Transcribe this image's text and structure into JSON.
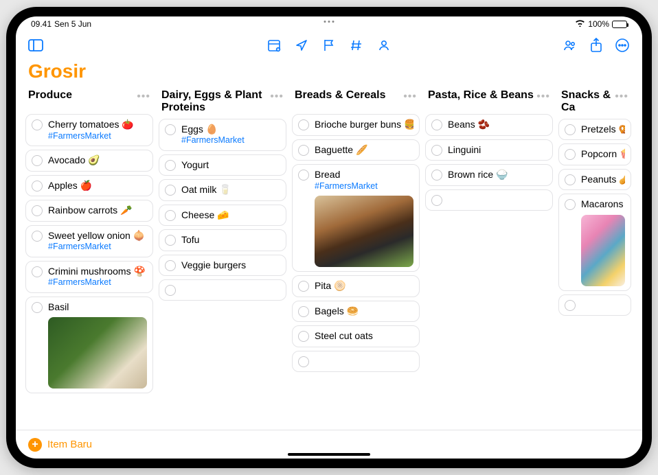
{
  "status": {
    "time": "09.41",
    "date": "Sen 5 Jun",
    "battery_pct": "100%",
    "wifi_icon": "wifi-icon",
    "battery_icon": "battery-icon"
  },
  "toolbar": {
    "sidebar_icon": "sidebar-toggle-icon",
    "calendar_icon": "calendar-icon",
    "location_icon": "location-icon",
    "flag_icon": "flag-icon",
    "hash_icon": "hash-icon",
    "person_icon": "person-icon",
    "share_icon": "share-icon",
    "collab_icon": "collaborate-icon",
    "more_icon": "ellipsis-circle-icon"
  },
  "title": "Grosir",
  "footer": {
    "new_item": "Item Baru"
  },
  "columns": [
    {
      "title": "Produce",
      "items": [
        {
          "label": "Cherry tomatoes 🍅",
          "tag": "#FarmersMarket"
        },
        {
          "label": "Avocado 🥑"
        },
        {
          "label": "Apples 🍎"
        },
        {
          "label": "Rainbow carrots 🥕"
        },
        {
          "label": "Sweet yellow onion 🧅",
          "tag": "#FarmersMarket"
        },
        {
          "label": "Crimini mushrooms 🍄",
          "tag": "#FarmersMarket"
        },
        {
          "label": "Basil",
          "image": "basil"
        }
      ]
    },
    {
      "title": "Dairy, Eggs & Plant Proteins",
      "items": [
        {
          "label": "Eggs 🥚",
          "tag": "#FarmersMarket"
        },
        {
          "label": "Yogurt"
        },
        {
          "label": "Oat milk 🥛"
        },
        {
          "label": "Cheese 🧀"
        },
        {
          "label": "Tofu"
        },
        {
          "label": "Veggie burgers"
        },
        {
          "empty": true
        }
      ]
    },
    {
      "title": "Breads & Cereals",
      "items": [
        {
          "label": "Brioche burger buns 🍔"
        },
        {
          "label": "Baguette 🥖"
        },
        {
          "label": "Bread",
          "tag": "#FarmersMarket",
          "image": "bread"
        },
        {
          "label": "Pita 🫓"
        },
        {
          "label": "Bagels 🥯"
        },
        {
          "label": "Steel cut oats"
        },
        {
          "empty": true
        }
      ]
    },
    {
      "title": "Pasta, Rice & Beans",
      "items": [
        {
          "label": "Beans 🫘"
        },
        {
          "label": "Linguini"
        },
        {
          "label": "Brown rice 🍚"
        },
        {
          "empty": true
        }
      ]
    },
    {
      "title": "Snacks & Ca",
      "cutoff": true,
      "items": [
        {
          "label": "Pretzels 🥨"
        },
        {
          "label": "Popcorn 🍿"
        },
        {
          "label": "Peanuts 🥜"
        },
        {
          "label": "Macarons",
          "image": "macarons"
        },
        {
          "empty": true
        }
      ]
    }
  ]
}
